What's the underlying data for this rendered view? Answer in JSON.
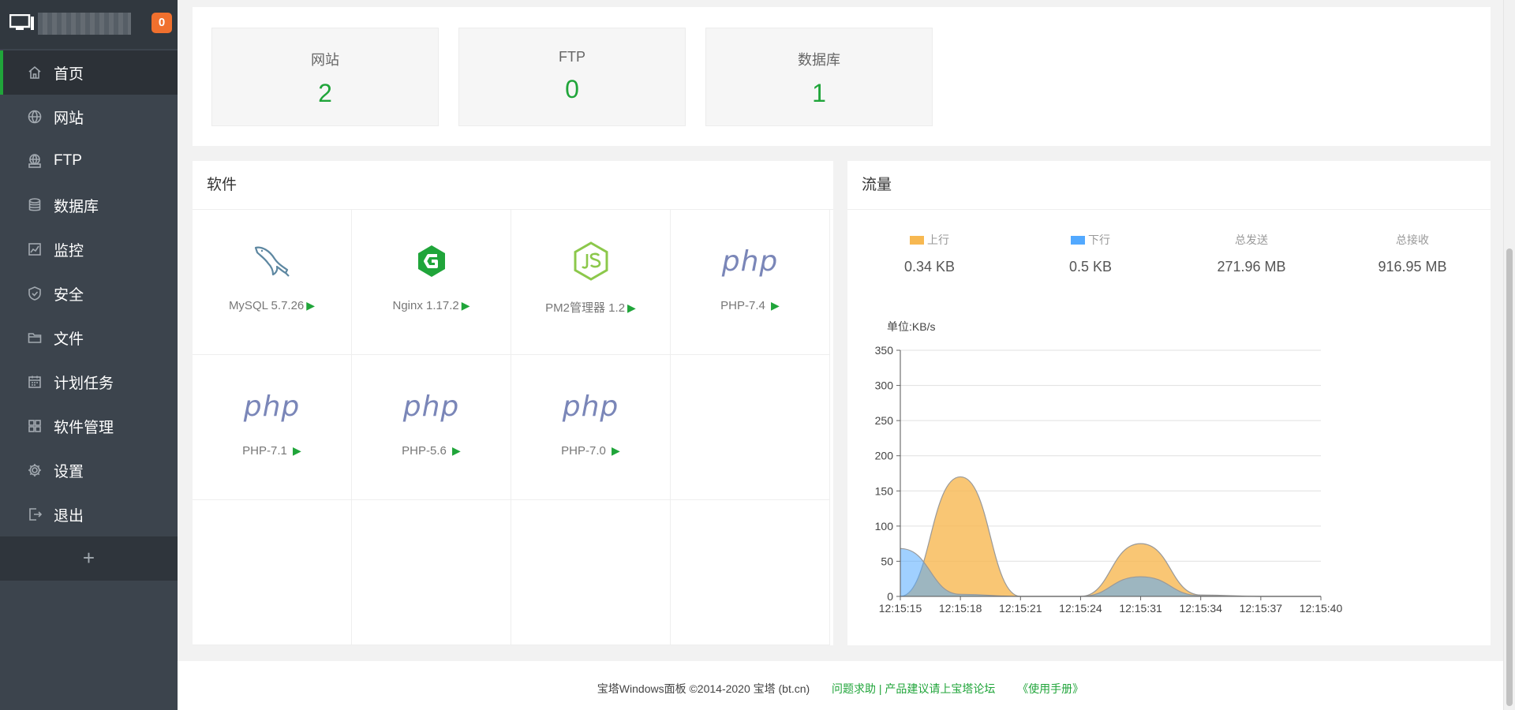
{
  "sidebar": {
    "badge": "0",
    "items": [
      {
        "label": "首页",
        "icon": "home-icon",
        "active": true
      },
      {
        "label": "网站",
        "icon": "globe-icon"
      },
      {
        "label": "FTP",
        "icon": "ftp-icon"
      },
      {
        "label": "数据库",
        "icon": "database-icon"
      },
      {
        "label": "监控",
        "icon": "monitor-chart-icon"
      },
      {
        "label": "安全",
        "icon": "shield-icon"
      },
      {
        "label": "文件",
        "icon": "folder-icon"
      },
      {
        "label": "计划任务",
        "icon": "calendar-icon"
      },
      {
        "label": "软件管理",
        "icon": "grid-icon"
      },
      {
        "label": "设置",
        "icon": "gear-icon"
      },
      {
        "label": "退出",
        "icon": "logout-icon"
      }
    ],
    "add_label": "+"
  },
  "stats": [
    {
      "label": "网站",
      "value": "2"
    },
    {
      "label": "FTP",
      "value": "0"
    },
    {
      "label": "数据库",
      "value": "1"
    }
  ],
  "software": {
    "title": "软件",
    "items": [
      {
        "name": "MySQL 5.7.26",
        "icon": "mysql-dolphin-icon"
      },
      {
        "name": "Nginx 1.17.2",
        "icon": "nginx-icon"
      },
      {
        "name": "PM2管理器 1.2",
        "icon": "nodejs-icon"
      },
      {
        "name": "PHP-7.4",
        "icon": "php-logo",
        "logo_text": "php"
      },
      {
        "name": "PHP-7.1",
        "icon": "php-logo",
        "logo_text": "php"
      },
      {
        "name": "PHP-5.6",
        "icon": "php-logo",
        "logo_text": "php"
      },
      {
        "name": "PHP-7.0",
        "icon": "php-logo",
        "logo_text": "php"
      }
    ],
    "play_glyph": "▶"
  },
  "flow": {
    "title": "流量",
    "up_label": "上行",
    "down_label": "下行",
    "total_sent_label": "总发送",
    "total_recv_label": "总接收",
    "up_value": "0.34 KB",
    "down_value": "0.5 KB",
    "total_sent_value": "271.96 MB",
    "total_recv_value": "916.95 MB",
    "unit": "单位:KB/s",
    "colors": {
      "up": "#f7b851",
      "down": "#52a9ff"
    }
  },
  "chart_data": {
    "type": "area",
    "x": [
      "12:15:15",
      "12:15:18",
      "12:15:21",
      "12:15:24",
      "12:15:31",
      "12:15:34",
      "12:15:37",
      "12:15:40"
    ],
    "ylim": [
      0,
      350
    ],
    "yticks": [
      0,
      50,
      100,
      150,
      200,
      250,
      300,
      350
    ],
    "series": [
      {
        "name": "上行",
        "values": [
          0,
          170,
          0,
          0,
          75,
          2,
          0,
          0
        ]
      },
      {
        "name": "下行",
        "values": [
          68,
          3,
          0,
          0,
          28,
          1,
          0,
          0
        ]
      }
    ]
  },
  "footer": {
    "copyright": "宝塔Windows面板 ©2014-2020 宝塔 (bt.cn)",
    "help_link": "问题求助 | 产品建议请上宝塔论坛",
    "manual_link": "《使用手册》"
  }
}
